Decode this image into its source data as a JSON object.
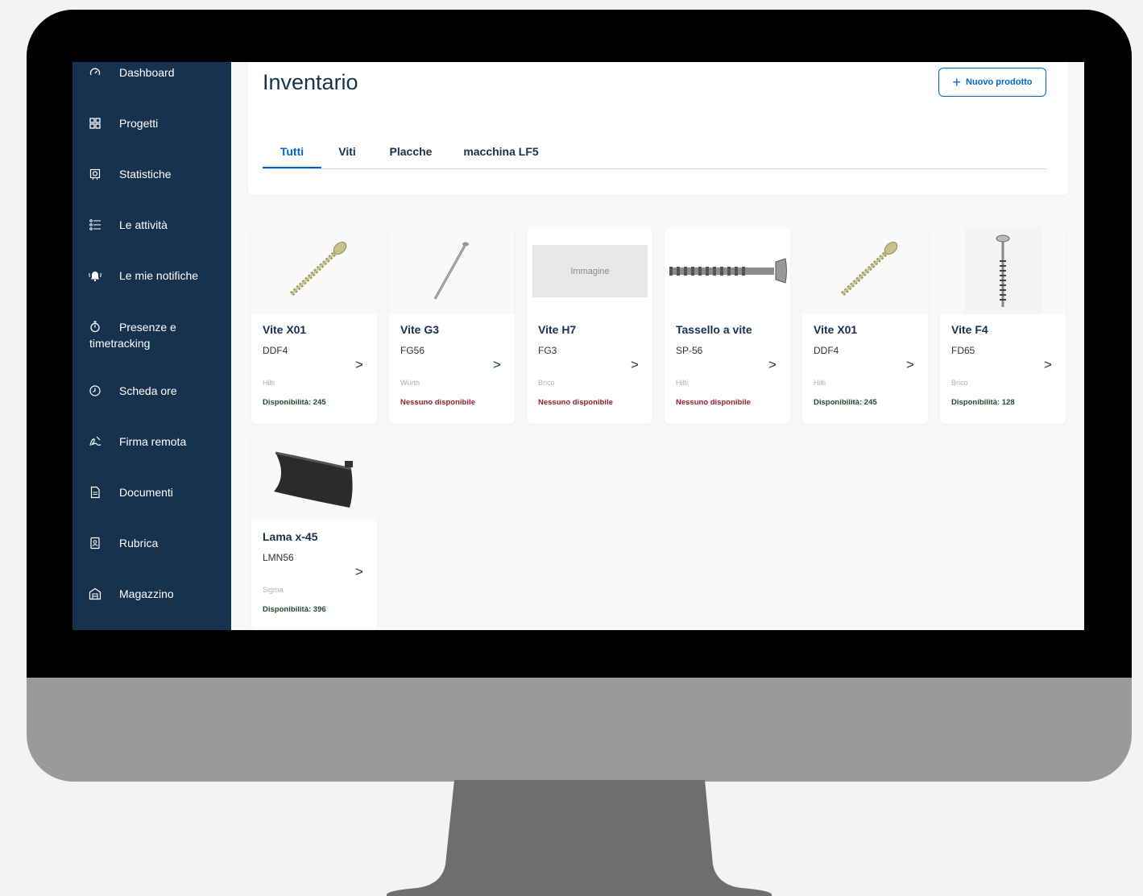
{
  "sidebar": {
    "items": [
      {
        "label": "Dashboard",
        "icon": "speedometer-icon"
      },
      {
        "label": "Progetti",
        "icon": "grid-icon"
      },
      {
        "label": "Statistiche",
        "icon": "chart-icon"
      },
      {
        "label": "Le attività",
        "icon": "checklist-icon"
      },
      {
        "label": "Le mie notifiche",
        "icon": "bell-icon"
      },
      {
        "label": "Presenze e timetracking",
        "icon": "stopwatch-icon"
      },
      {
        "label": "Scheda ore",
        "icon": "clock-icon"
      },
      {
        "label": "Firma remota",
        "icon": "signature-icon"
      },
      {
        "label": "Documenti",
        "icon": "document-icon"
      },
      {
        "label": "Rubrica",
        "icon": "contacts-icon"
      },
      {
        "label": "Magazzino",
        "icon": "warehouse-icon"
      }
    ]
  },
  "header": {
    "title": "Inventario",
    "new_button_label": "Nuovo prodotto",
    "new_button_icon": "plus-icon"
  },
  "tabs": [
    {
      "label": "Tutti",
      "active": true
    },
    {
      "label": "Viti",
      "active": false
    },
    {
      "label": "Placche",
      "active": false
    },
    {
      "label": "macchina LF5",
      "active": false
    }
  ],
  "products": [
    {
      "name": "Vite X01",
      "code": "DDF4",
      "brand": "Hilti",
      "availability": "Disponibilità: 245",
      "status": "ok",
      "image": "screw-diagonal"
    },
    {
      "name": "Vite G3",
      "code": "FG56",
      "brand": "Würth",
      "availability": "Nessuno disponibile",
      "status": "none",
      "image": "nail-thin"
    },
    {
      "name": "Vite H7",
      "code": "FG3",
      "brand": "Brico",
      "availability": "Nessuno disponibile",
      "status": "none",
      "image": "placeholder",
      "image_label": "Immagine"
    },
    {
      "name": "Tassello a vite",
      "code": "SP-56",
      "brand": "Hilti",
      "availability": "Nessuno disponibile",
      "status": "none",
      "image": "anchor-horizontal"
    },
    {
      "name": "Vite X01",
      "code": "DDF4",
      "brand": "Hilti",
      "availability": "Disponibilità: 245",
      "status": "ok",
      "image": "screw-diagonal"
    },
    {
      "name": "Vite F4",
      "code": "FD65",
      "brand": "Brico",
      "availability": "Disponibilità: 128",
      "status": "ok",
      "image": "screw-vertical"
    },
    {
      "name": "Lama x-45",
      "code": "LMN56",
      "brand": "Sigma",
      "availability": "Disponibilità: 396",
      "status": "ok",
      "image": "blade"
    }
  ],
  "colors": {
    "sidebar_bg": "#17324f",
    "accent": "#0066cc",
    "available": "#1e4d2b",
    "unavailable": "#9b1c2c"
  }
}
